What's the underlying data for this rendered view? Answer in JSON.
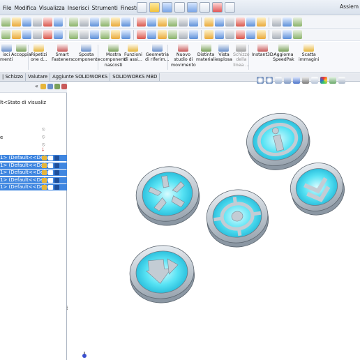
{
  "menu": {
    "items": [
      "File",
      "Modifica",
      "Visualizza",
      "Inserisci",
      "Strumenti",
      "Finestra",
      "?"
    ],
    "right_label": "Assiem"
  },
  "command_manager": {
    "buttons": [
      {
        "label": "isci\nmenti",
        "dim": false
      },
      {
        "label": "Accoppia",
        "dim": false
      },
      {
        "label": "Ripetizi\none d...",
        "dim": false
      },
      {
        "label": "Smart\nFasteners",
        "dim": false
      },
      {
        "label": "Sposta\ncomponente",
        "dim": false
      },
      {
        "label": "Mostra\ncomponenti\nnascosti",
        "dim": false
      },
      {
        "label": "Funzioni\ndi assi...",
        "dim": false
      },
      {
        "label": "Geometria\ndi riferim...",
        "dim": false
      },
      {
        "label": "Nuovo\nstudio di\nmovimento",
        "dim": false
      },
      {
        "label": "Distinta\nmateriali",
        "dim": false
      },
      {
        "label": "Vista\nesplosa",
        "dim": false
      },
      {
        "label": "Schizzo\ndella\nlinea ...",
        "dim": true
      },
      {
        "label": "Instant3D",
        "dim": false
      },
      {
        "label": "Aggiorna\nSpeedPak",
        "dim": false
      },
      {
        "label": "Scatta\nimmagini",
        "dim": false
      }
    ]
  },
  "tabs": [
    "| Schizzo",
    "Valutare",
    "Aggiunte SOLIDWORKS",
    "SOLIDWORKS MBD"
  ],
  "feature_tree": {
    "collapse_glyph": "«",
    "config_text": "lt<Stato di visualiz",
    "partial_item": "e",
    "selected_rows": [
      "1> (Default<<Defa",
      "1> (Default<<Defa",
      "1> (Default<<Defa",
      "1> (Default<<Defa",
      "1> (Default<<Defa"
    ]
  },
  "splitter_glyph": "⁞",
  "colors": {
    "selection": "#3f86e0",
    "coin_glow": "#3cd6ee",
    "coin_rim": "#b8c2cc",
    "toolbar_bg": "#f3f5f9"
  }
}
